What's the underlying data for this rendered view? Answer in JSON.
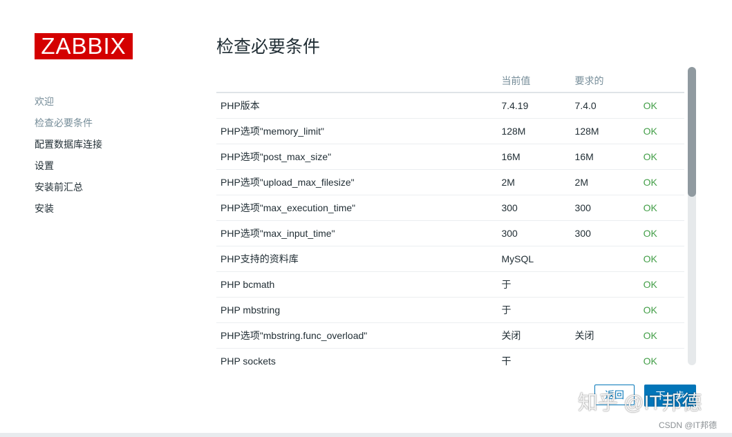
{
  "logo": {
    "text": "ZABBIX",
    "color": "#d40000"
  },
  "sidebar": {
    "steps": [
      {
        "label": "欢迎",
        "state": "done"
      },
      {
        "label": "检查必要条件",
        "state": "current"
      },
      {
        "label": "配置数据库连接",
        "state": "pending"
      },
      {
        "label": "设置",
        "state": "pending"
      },
      {
        "label": "安装前汇总",
        "state": "pending"
      },
      {
        "label": "安装",
        "state": "pending"
      }
    ]
  },
  "main": {
    "title": "检查必要条件",
    "table": {
      "headers": [
        "",
        "当前值",
        "要求的",
        ""
      ],
      "rows": [
        {
          "name": "PHP版本",
          "current": "7.4.19",
          "required": "7.4.0",
          "status": "OK"
        },
        {
          "name": "PHP选项\"memory_limit\"",
          "current": "128M",
          "required": "128M",
          "status": "OK"
        },
        {
          "name": "PHP选项\"post_max_size\"",
          "current": "16M",
          "required": "16M",
          "status": "OK"
        },
        {
          "name": "PHP选项\"upload_max_filesize\"",
          "current": "2M",
          "required": "2M",
          "status": "OK"
        },
        {
          "name": "PHP选项\"max_execution_time\"",
          "current": "300",
          "required": "300",
          "status": "OK"
        },
        {
          "name": "PHP选项\"max_input_time\"",
          "current": "300",
          "required": "300",
          "status": "OK"
        },
        {
          "name": "PHP支持的资料库",
          "current": "MySQL",
          "required": "",
          "status": "OK"
        },
        {
          "name": "PHP bcmath",
          "current": "于",
          "required": "",
          "status": "OK"
        },
        {
          "name": "PHP mbstring",
          "current": "于",
          "required": "",
          "status": "OK"
        },
        {
          "name": "PHP选项\"mbstring.func_overload\"",
          "current": "关闭",
          "required": "关闭",
          "status": "OK"
        },
        {
          "name": "PHP sockets",
          "current": "干",
          "required": "",
          "status": "OK"
        }
      ]
    },
    "scrollbar": {
      "position": 0.0
    }
  },
  "buttons": {
    "back": "返回",
    "next": "下一步"
  },
  "watermarks": {
    "zhihu": "知乎 @IT邦德",
    "csdn": "CSDN @IT邦德"
  },
  "colors": {
    "accent": "#0275b8",
    "ok": "#429e47",
    "muted": "#768d99",
    "text": "#1f2c33"
  }
}
